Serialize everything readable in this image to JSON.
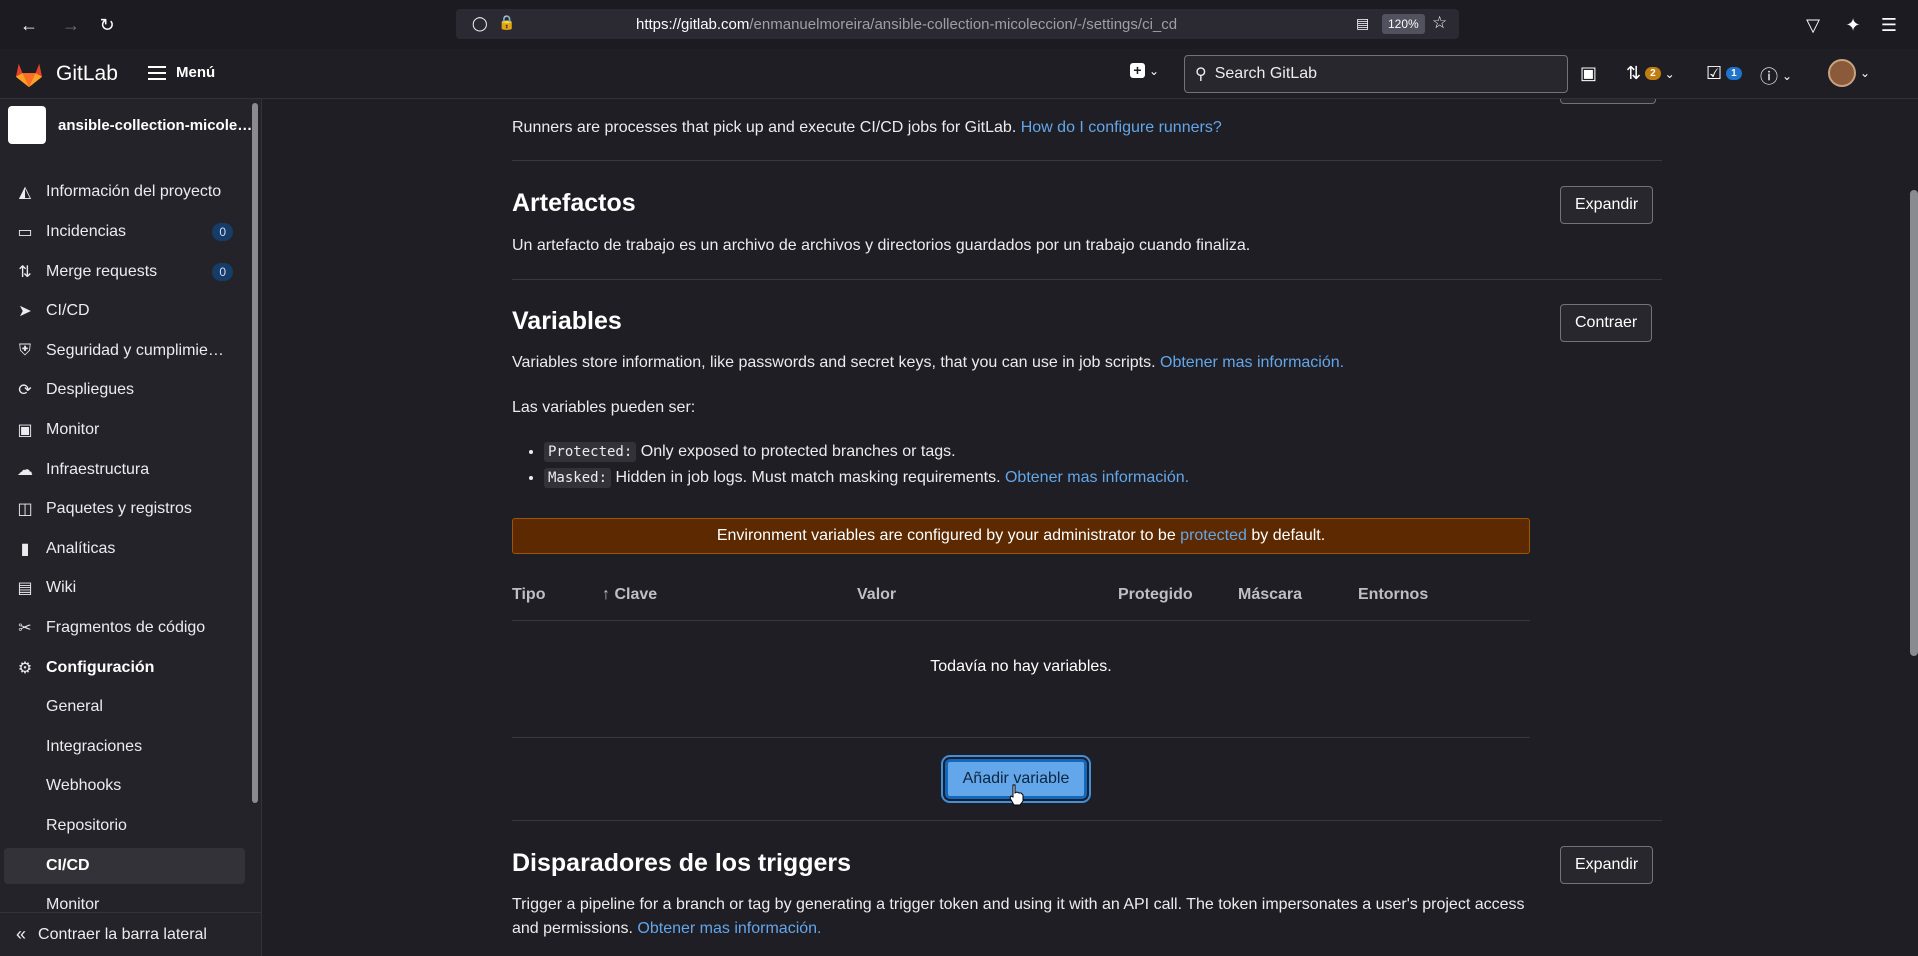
{
  "browser": {
    "url_domain": "https://gitlab.com",
    "url_path": "/enmanuelmoreira/ansible-collection-micoleccion/-/settings/ci_cd",
    "zoom": "120%"
  },
  "header": {
    "brand": "GitLab",
    "menu_label": "Menú",
    "search_placeholder": "Search GitLab",
    "mr_count": "2",
    "todo_count": "1"
  },
  "sidebar": {
    "project_name": "ansible-collection-micoleccion",
    "items": [
      {
        "label": "Información del proyecto",
        "icon": "project-icon"
      },
      {
        "label": "Incidencias",
        "icon": "issues-icon",
        "count": "0"
      },
      {
        "label": "Merge requests",
        "icon": "merge-request-icon",
        "count": "0"
      },
      {
        "label": "CI/CD",
        "icon": "rocket-icon"
      },
      {
        "label": "Seguridad y cumplimiento",
        "icon": "shield-icon"
      },
      {
        "label": "Despliegues",
        "icon": "deploy-icon"
      },
      {
        "label": "Monitor",
        "icon": "monitor-icon"
      },
      {
        "label": "Infraestructura",
        "icon": "cloud-icon"
      },
      {
        "label": "Paquetes y registros",
        "icon": "package-icon"
      },
      {
        "label": "Analíticas",
        "icon": "chart-icon"
      },
      {
        "label": "Wiki",
        "icon": "book-icon"
      },
      {
        "label": "Fragmentos de código",
        "icon": "snippet-icon"
      },
      {
        "label": "Configuración",
        "icon": "gear-icon"
      }
    ],
    "sub_items": [
      "General",
      "Integraciones",
      "Webhooks",
      "Repositorio",
      "CI/CD",
      "Monitor"
    ],
    "collapse_label": "Contraer la barra lateral"
  },
  "main": {
    "runners_text": "Runners are processes that pick up and execute CI/CD jobs for GitLab.",
    "runners_link": "How do I configure runners?",
    "artifacts": {
      "title": "Artefactos",
      "description": "Un artefacto de trabajo es un archivo de archivos y directorios guardados por un trabajo cuando finaliza.",
      "button": "Expandir"
    },
    "variables": {
      "title": "Variables",
      "button": "Contraer",
      "description": "Variables store information, like passwords and secret keys, that you can use in job scripts.",
      "more_link": "Obtener mas información.",
      "can_be": "Las variables pueden ser:",
      "protected_code": "Protected:",
      "protected_text": "Only exposed to protected branches or tags.",
      "masked_code": "Masked:",
      "masked_text": "Hidden in job logs. Must match masking requirements.",
      "masked_link": "Obtener mas información.",
      "alert_pre": "Environment variables are configured by your administrator to be",
      "alert_link": "protected",
      "alert_post": "by default.",
      "columns": [
        "Tipo",
        "Clave",
        "Valor",
        "Protegido",
        "Máscara",
        "Entornos"
      ],
      "empty": "Todavía no hay variables.",
      "add_button": "Añadir variable"
    },
    "triggers": {
      "title": "Disparadores de los triggers",
      "button": "Expandir",
      "description": "Trigger a pipeline for a branch or tag by generating a trigger token and using it with an API call. The token impersonates a user's project access and permissions.",
      "more_link": "Obtener mas información."
    }
  }
}
